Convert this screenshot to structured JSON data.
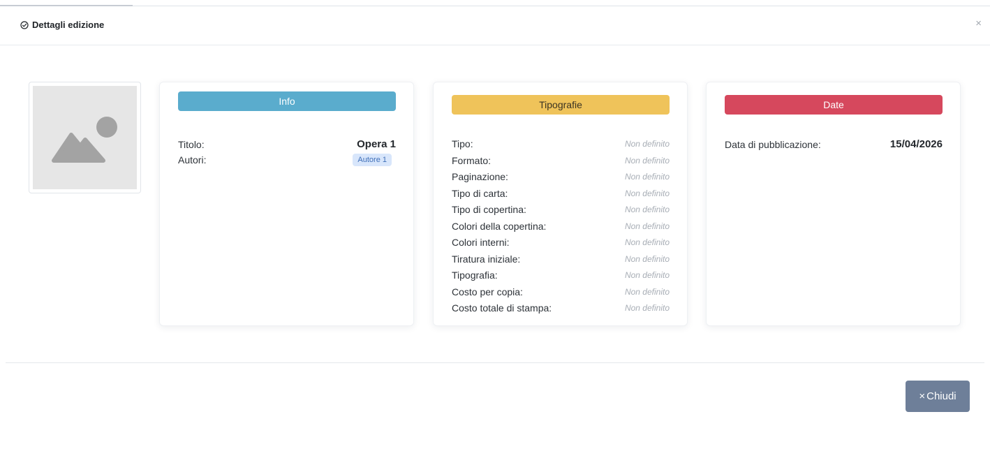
{
  "modal": {
    "title": "Dettagli edizione",
    "close_glyph": "×",
    "title_icon": "check-circle-icon"
  },
  "cover": {
    "icon": "image-placeholder-icon"
  },
  "info": {
    "header": "Info",
    "color": "#5aaccd",
    "titolo_label": "Titolo:",
    "titolo_value": "Opera 1",
    "autori_label": "Autori:",
    "autori": [
      "Autore 1"
    ]
  },
  "tipografie": {
    "header": "Tipografie",
    "color": "#efc35a",
    "rows": [
      {
        "label": "Tipo:",
        "value": "Non definito"
      },
      {
        "label": "Formato:",
        "value": "Non definito"
      },
      {
        "label": "Paginazione:",
        "value": "Non definito"
      },
      {
        "label": "Tipo di carta:",
        "value": "Non definito"
      },
      {
        "label": "Tipo di copertina:",
        "value": "Non definito"
      },
      {
        "label": "Colori della copertina:",
        "value": "Non definito"
      },
      {
        "label": "Colori interni:",
        "value": "Non definito"
      },
      {
        "label": "Tiratura iniziale:",
        "value": "Non definito"
      },
      {
        "label": "Tipografia:",
        "value": "Non definito"
      },
      {
        "label": "Costo per copia:",
        "value": "Non definito"
      },
      {
        "label": "Costo totale di stampa:",
        "value": "Non definito"
      }
    ]
  },
  "date": {
    "header": "Date",
    "color": "#d6485d",
    "pubblicazione_label": "Data di pubblicazione:",
    "pubblicazione_value": "15/04/2026"
  },
  "footer": {
    "close_button_glyph": "×",
    "close_button_label": "Chiudi",
    "close_button_color": "#6e7f99"
  }
}
